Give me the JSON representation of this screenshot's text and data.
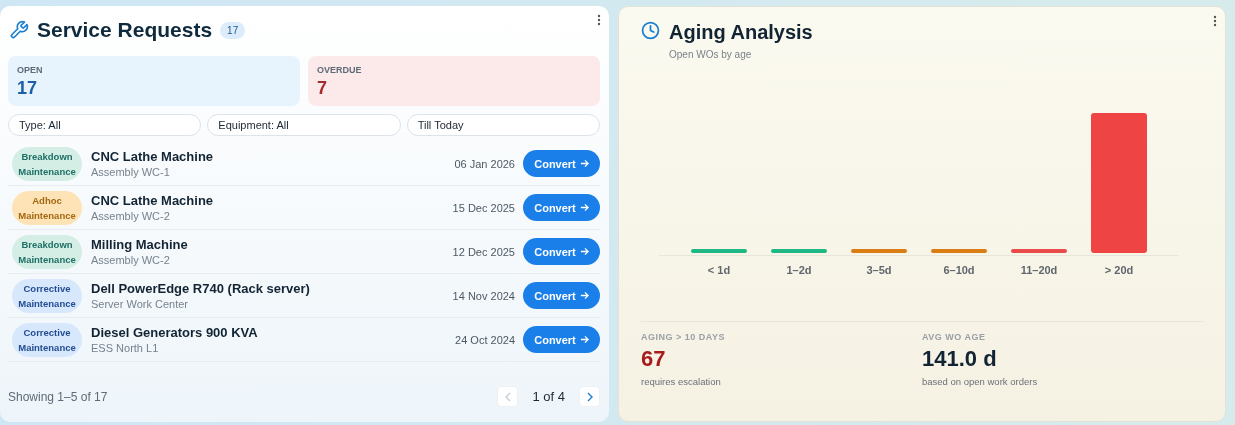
{
  "service_requests": {
    "title": "Service Requests",
    "count": "17",
    "stats": [
      {
        "kind": "open",
        "label": "OPEN",
        "value": "17"
      },
      {
        "kind": "overdue",
        "label": "OVERDUE",
        "value": "7"
      }
    ],
    "filters": [
      "Type: All",
      "Equipment: All",
      "Till Today"
    ],
    "rows": [
      {
        "kind": "breakdown",
        "type": [
          "Breakdown",
          "Maintenance"
        ],
        "name": "CNC Lathe Machine",
        "location": "Assembly WC-1",
        "date": "06 Jan 2026",
        "action": "Convert"
      },
      {
        "kind": "adhoc",
        "type": [
          "Adhoc",
          "Maintenance"
        ],
        "name": "CNC Lathe Machine",
        "location": "Assembly WC-2",
        "date": "15 Dec 2025",
        "action": "Convert"
      },
      {
        "kind": "breakdown",
        "type": [
          "Breakdown",
          "Maintenance"
        ],
        "name": "Milling Machine",
        "location": "Assembly WC-2",
        "date": "12 Dec 2025",
        "action": "Convert"
      },
      {
        "kind": "corrective",
        "type": [
          "Corrective",
          "Maintenance"
        ],
        "name": "Dell PowerEdge R740 (Rack server)",
        "location": "Server Work Center",
        "date": "14 Nov 2024",
        "action": "Convert"
      },
      {
        "kind": "corrective",
        "type": [
          "Corrective",
          "Maintenance"
        ],
        "name": "Diesel Generators 900 KVA",
        "location": "ESS North L1",
        "date": "24 Oct 2024",
        "action": "Convert"
      }
    ],
    "showing": "Showing 1–5 of 17",
    "page": "1 of 4",
    "prev_disabled": true,
    "next_disabled": false
  },
  "aging": {
    "title": "Aging Analysis",
    "subtitle": "Open WOs by age",
    "bars": [
      {
        "label": "< 1d",
        "color": "#1fb884"
      },
      {
        "label": "1–2d",
        "color": "#1fb884"
      },
      {
        "label": "3–5d",
        "color": "#d97d14"
      },
      {
        "label": "6–10d",
        "color": "#d97d14"
      },
      {
        "label": "11–20d",
        "color": "#e94a4a"
      },
      {
        "label": "> 20d",
        "color": "#ef4444"
      }
    ],
    "metrics": [
      {
        "kind": "alert",
        "label": "AGING > 10 DAYS",
        "value": "67",
        "note": "requires escalation"
      },
      {
        "kind": "plain",
        "label": "AVG WO AGE",
        "value": "141.0 d",
        "note": "based on open work orders"
      }
    ]
  }
}
